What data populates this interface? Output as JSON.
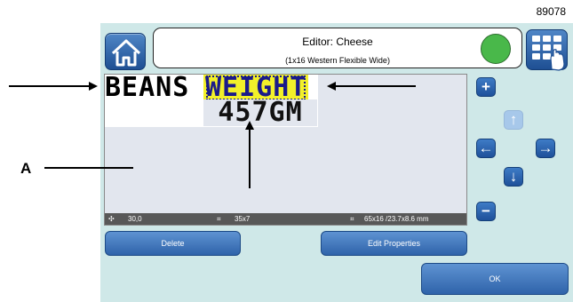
{
  "figure_number": "89078",
  "header": {
    "title": "Editor: Cheese",
    "subtitle": "(1x16 Western Flexible Wide)",
    "status_color": "#49b84a"
  },
  "canvas": {
    "fields": [
      "BEANS",
      "WEIGHT",
      "457GM"
    ],
    "selected_field": "WEIGHT",
    "selection_color": "#f2f02a"
  },
  "statusbar": {
    "position": "30,0",
    "field_size": "35x7",
    "message_size": "65x16 /23.7x8.6 mm"
  },
  "buttons": {
    "delete": "Delete",
    "edit_properties": "Edit Properties",
    "ok": "OK"
  },
  "annotation": {
    "label": "A"
  },
  "icons": [
    "home-icon",
    "keypad-menu-icon",
    "zoom-in-icon",
    "zoom-out-icon",
    "arrow-up-icon",
    "arrow-left-icon",
    "arrow-right-icon",
    "arrow-down-icon",
    "move-icon",
    "field-size-icon",
    "message-size-icon"
  ]
}
